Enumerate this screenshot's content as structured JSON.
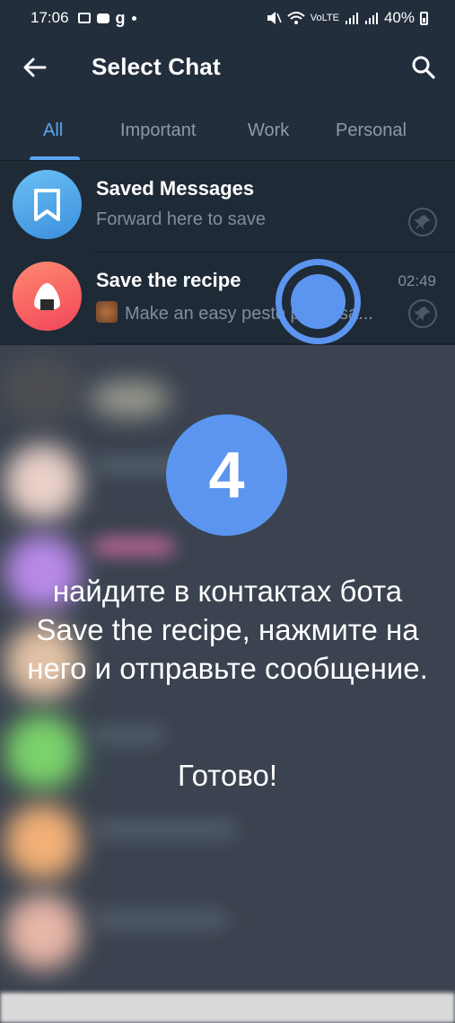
{
  "status": {
    "time": "17:06",
    "battery": "40%",
    "network": "VoLTE"
  },
  "appbar": {
    "title": "Select Chat"
  },
  "tabs": [
    {
      "label": "All",
      "active": true
    },
    {
      "label": "Important",
      "active": false
    },
    {
      "label": "Work",
      "active": false
    },
    {
      "label": "Personal",
      "active": false
    }
  ],
  "chats": [
    {
      "name": "Saved Messages",
      "preview": "Forward here to save",
      "time": "",
      "pinned": true,
      "icon": "bookmark-icon"
    },
    {
      "name": "Save the recipe",
      "preview": "Make an easy pesto pasta sa...",
      "time": "02:49",
      "pinned": true,
      "icon": "onigiri-icon"
    }
  ],
  "overlay": {
    "step": "4",
    "instruction": "найдите в контактах бота Save the recipe, нажмите на него и отправьте сообщение.",
    "done": "Готово!"
  },
  "colors": {
    "accent": "#5aa6f0",
    "badge": "#5b95f0",
    "header": "#232e3c"
  }
}
